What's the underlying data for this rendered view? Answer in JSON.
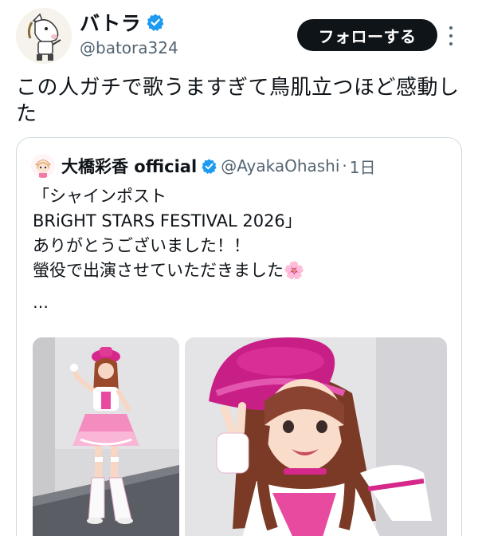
{
  "author": {
    "display_name": "バトラ",
    "handle": "@batora324",
    "verified": true,
    "avatar_icon": "horse-mascot-avatar"
  },
  "follow_button_label": "フォローする",
  "more_icon": "more-options-icon",
  "tweet_text": "この人ガチで歌うますぎて鳥肌立つほど感動した",
  "quote": {
    "display_name": "大橋彩香 official",
    "handle": "@AyakaOhashi",
    "separator": "·",
    "time": "1日",
    "verified": true,
    "body_lines": [
      "「シャインポスト",
      "BRiGHT STARS FESTIVAL 2026」",
      "ありがとうございました！！",
      "螢役で出演させていただきました"
    ],
    "emoji": "🌸",
    "ellipsis": "…",
    "media": [
      {
        "name": "performer-full-body-photo"
      },
      {
        "name": "performer-selfie-photo"
      }
    ]
  },
  "colors": {
    "verified_blue": "#1d9bf0",
    "follow_bg": "#0f1419",
    "secondary_text": "#536471",
    "border": "#cfd9de",
    "costume_pink": "#d6278a"
  }
}
